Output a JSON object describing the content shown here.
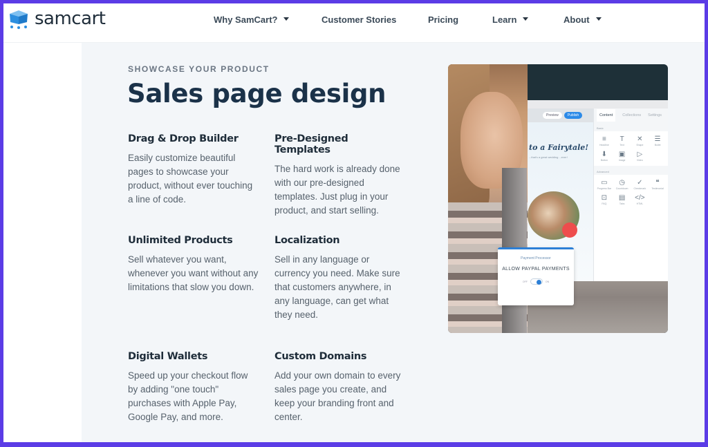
{
  "brand": {
    "name": "samcart",
    "logo_icon": "shopping-cart-box-icon",
    "frame_color": "#5b3ce6",
    "logo_color": "#2d8fe0"
  },
  "nav": {
    "items": [
      {
        "label": "Why SamCart?",
        "has_dropdown": true
      },
      {
        "label": "Customer Stories",
        "has_dropdown": false
      },
      {
        "label": "Pricing",
        "has_dropdown": false
      },
      {
        "label": "Learn",
        "has_dropdown": true
      },
      {
        "label": "About",
        "has_dropdown": true
      }
    ]
  },
  "section": {
    "eyebrow": "SHOWCASE YOUR PRODUCT",
    "title": "Sales page design",
    "features": [
      {
        "title": "Drag & Drop Builder",
        "body": "Easily customize beautiful pages to showcase your product, without ever touching a line of code."
      },
      {
        "title": "Pre-Designed Templates",
        "body": "The hard work is already done with our pre-designed templates. Just plug in your product, and start selling."
      },
      {
        "title": "Unlimited Products",
        "body": "Sell whatever you want, whenever you want without any limitations that slow you down."
      },
      {
        "title": "Localization",
        "body": "Sell in any language or currency you need. Make sure that customers anywhere, in any language, can get what they need."
      },
      {
        "title": "Digital Wallets",
        "body": "Speed up your checkout flow by adding \"one touch\" purchases with Apple Pay, Google Pay, and more."
      },
      {
        "title": "Custom Domains",
        "body": "Add your own domain to every sales page you create, and keep your branding front and center."
      }
    ]
  },
  "hero_image": {
    "alt": "Woman using SamCart page builder",
    "builder": {
      "toolbar": {
        "preview": "Preview",
        "publish": "Publish"
      },
      "canvas_heading": "to a Fairytale!",
      "canvas_sub": "...that's a great wedding ...ever!",
      "panel_tabs": [
        "Content",
        "Collections",
        "Settings"
      ],
      "section_basic": "Basic",
      "section_advanced": "Advanced",
      "basic_icons": [
        {
          "label": "Headline",
          "glyph": "≡"
        },
        {
          "label": "Text",
          "glyph": "T"
        },
        {
          "label": "Shape",
          "glyph": "✕"
        },
        {
          "label": "Bullet",
          "glyph": "☰"
        },
        {
          "label": "Button",
          "glyph": "⬇"
        },
        {
          "label": "Image",
          "glyph": "▣"
        },
        {
          "label": "Video",
          "glyph": "▷"
        }
      ],
      "advanced_icons": [
        {
          "label": "Progress Bar",
          "glyph": "▭"
        },
        {
          "label": "Countdown",
          "glyph": "◷"
        },
        {
          "label": "Checkmark",
          "glyph": "✓"
        },
        {
          "label": "Testimonial",
          "glyph": "❝"
        },
        {
          "label": "FAQ",
          "glyph": "⊡"
        },
        {
          "label": "Tabs",
          "glyph": "▤"
        },
        {
          "label": "HTML",
          "glyph": "</>"
        }
      ]
    },
    "payment_card": {
      "title": "Payment Processor",
      "label": "ALLOW PAYPAL PAYMENTS",
      "toggle_off": "OFF",
      "toggle_on": "ON",
      "enabled": true
    }
  }
}
